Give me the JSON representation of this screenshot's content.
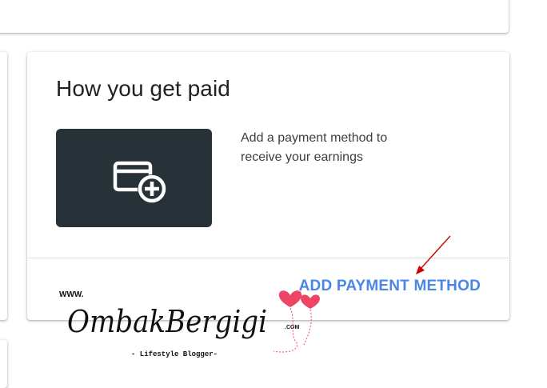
{
  "main_card": {
    "title": "How you get paid",
    "description": "Add a payment method to receive your earnings",
    "action_label": "ADD PAYMENT METHOD"
  },
  "watermark": {
    "prefix": "WWW.",
    "name": "OmbakBergigi",
    "suffix": ".COM",
    "tagline": "- Lifestyle Blogger-"
  },
  "colors": {
    "action": "#4a86e8",
    "tile": "#263238",
    "arrow": "#d00000",
    "hearts": "#ee4466"
  },
  "icons": {
    "payment_tile": "add-card-icon",
    "annotation": "arrow-icon",
    "watermark": "hearts-icon"
  }
}
